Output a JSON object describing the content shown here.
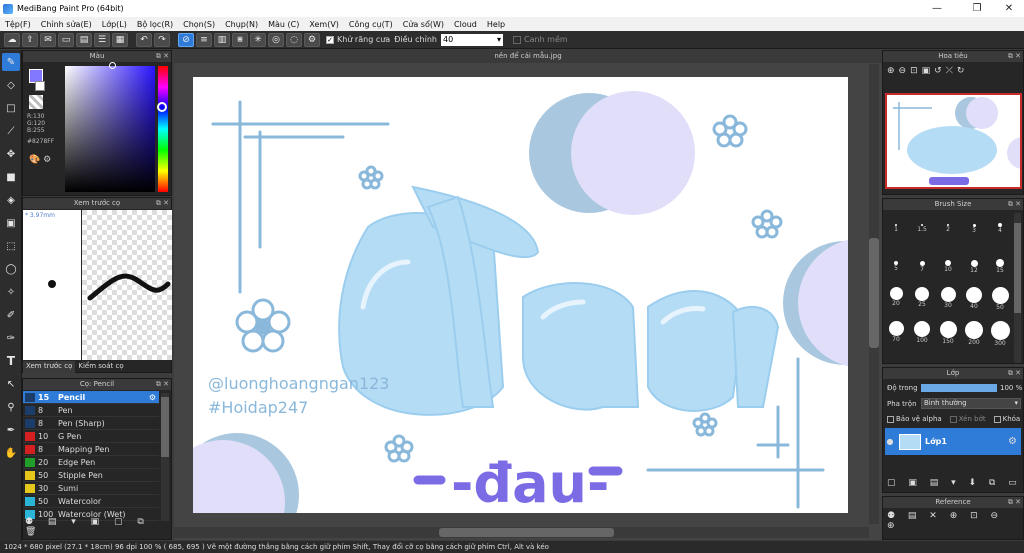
{
  "window": {
    "title": "MediBang Paint Pro (64bit)",
    "minimize": "—",
    "maximize": "❐",
    "close": "✕"
  },
  "menu": [
    "Tệp(F)",
    "Chỉnh sửa(E)",
    "Lớp(L)",
    "Bộ lọc(R)",
    "Chọn(S)",
    "Chụp(N)",
    "Màu (C)",
    "Xem(V)",
    "Công cụ(T)",
    "Cửa sổ(W)",
    "Cloud",
    "Help"
  ],
  "toolbar": {
    "antialias_label": "Khử răng cưa",
    "correction_label": "Điều chỉnh",
    "correction_value": "40",
    "snap_label": "Canh mềm"
  },
  "canvas": {
    "tab_title": "nền để cái mẫu.jpg"
  },
  "color_panel": {
    "title": "Màu",
    "r": "R:130",
    "g": "G:120",
    "b": "B:255",
    "hex": "#8278FF",
    "main_color": "#8278FF"
  },
  "preview_panel": {
    "title": "Xem trước cọ",
    "size": "3.97mm",
    "tab1": "Xem trước cọ",
    "tab2": "Kiểm soát cọ"
  },
  "brush_panel": {
    "title": "Cọ: Pencil",
    "items": [
      {
        "size": "15",
        "name": "Pencil",
        "color": "#1c3c6a"
      },
      {
        "size": "8",
        "name": "Pen",
        "color": "#1c3c6a"
      },
      {
        "size": "8",
        "name": "Pen (Sharp)",
        "color": "#1c3c6a"
      },
      {
        "size": "10",
        "name": "G Pen",
        "color": "#d42020"
      },
      {
        "size": "8",
        "name": "Mapping Pen",
        "color": "#d42020"
      },
      {
        "size": "20",
        "name": "Edge Pen",
        "color": "#1f9e2a"
      },
      {
        "size": "50",
        "name": "Stipple Pen",
        "color": "#e5c61a"
      },
      {
        "size": "30",
        "name": "Sumi",
        "color": "#e5c61a"
      },
      {
        "size": "50",
        "name": "Watercolor",
        "color": "#2ab5d6"
      },
      {
        "size": "100",
        "name": "Watercolor (Wet)",
        "color": "#2ab5d6"
      }
    ]
  },
  "navigator": {
    "title": "Hoa tiêu"
  },
  "brush_size": {
    "title": "Brush Size",
    "sizes": [
      "1",
      "1.5",
      "2",
      "3",
      "4",
      "5",
      "7",
      "10",
      "12",
      "15",
      "20",
      "25",
      "30",
      "40",
      "50",
      "70",
      "100",
      "150",
      "200",
      "300"
    ]
  },
  "layer_panel": {
    "title": "Lớp",
    "opacity_label": "Độ trong",
    "opacity_value": "100 %",
    "blend_label": "Pha trộn",
    "blend_value": "Bình thường",
    "protect_alpha": "Bảo vệ alpha",
    "clipping": "Xén bớt",
    "lock": "Khóa",
    "layer_name": "Lớp1"
  },
  "reference": {
    "title": "Reference"
  },
  "artwork": {
    "watermark1": "@luonghoangngan123",
    "watermark2": "#Hoidap247",
    "subtitle": "-đau-"
  },
  "status": {
    "text": "1024 * 680 pixel   (27.1 * 18cm)   96 dpi   100 %   ( 685, 695 )   Vẽ một đường thẳng bằng cách giữ phím Shift, Thay đổi cỡ cọ bằng cách giữ phím Ctrl, Alt và kéo"
  }
}
